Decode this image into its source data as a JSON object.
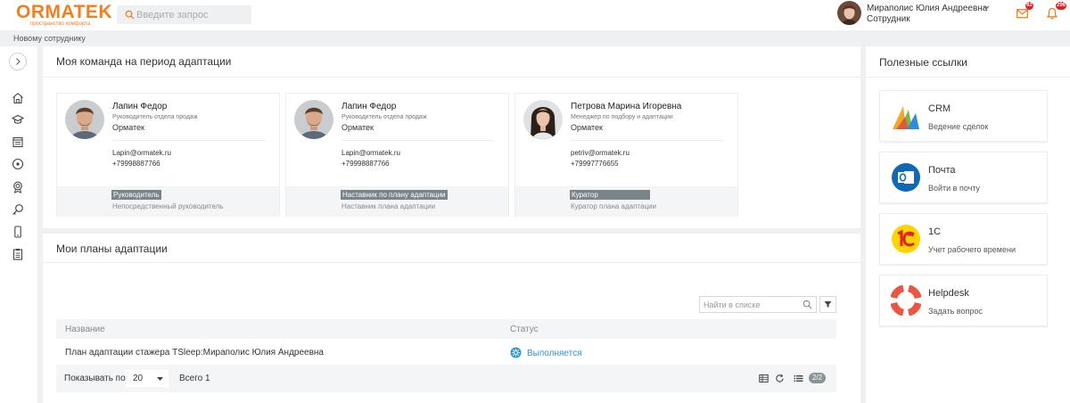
{
  "header": {
    "logo_text": "ORMATEK",
    "logo_subtitle": "пространство комфорта",
    "search_placeholder": "Введите запрос",
    "user_name": "Мираполис Юлия Андреевна",
    "user_role": "Сотрудник",
    "mail_badge": "62",
    "bell_badge": "298"
  },
  "breadcrumb": "Новому сотруднику",
  "team": {
    "title": "Моя команда на период адаптации",
    "members": [
      {
        "name": "Лапин Федор",
        "position": "Руководитель отдела продаж",
        "company": "Орматек",
        "email": "Lapin@ormatek.ru",
        "phone": "+79998887766",
        "role_tag": "Руководитель",
        "role_desc": "Непосредственный руководитель"
      },
      {
        "name": "Лапин Федор",
        "position": "Руководитель отдела продаж",
        "company": "Орматек",
        "email": "Lapin@ormatek.ru",
        "phone": "+79998887766",
        "role_tag": "Наставник по плану адаптации",
        "role_desc": "Наставник плана адаптации"
      },
      {
        "name": "Петрова Марина Игоревна",
        "position": "Менеджер по подбору и адаптации",
        "company": "Орматек",
        "email": "petriv@ormatek.ru",
        "phone": "+79997776655",
        "role_tag": "Куратор",
        "role_desc": "Куратор плана адаптации"
      }
    ]
  },
  "plans": {
    "title": "Мои планы адаптации",
    "find_placeholder": "Найти в списке",
    "columns": [
      "Название",
      "Статус"
    ],
    "rows": [
      {
        "name": "План адаптации стажера TSleep:Мираполис Юлия Андреевна",
        "status": "Выполняется"
      }
    ],
    "per_page_label": "Показывать по",
    "per_page_value": "20",
    "total": "Всего 1",
    "pages": "2/2"
  },
  "links": {
    "title": "Полезные ссылки",
    "items": [
      {
        "title": "CRM",
        "subtitle": "Ведение сделок"
      },
      {
        "title": "Почта",
        "subtitle": "Войти в почту"
      },
      {
        "title": "1С",
        "subtitle": "Учет рабочего времени"
      },
      {
        "title": "Helpdesk",
        "subtitle": "Задать вопрос"
      }
    ]
  },
  "colors": {
    "brand": "#f07f1f",
    "link": "#2c95d8",
    "badge": "#e21f26",
    "tag": "#7b8589"
  }
}
